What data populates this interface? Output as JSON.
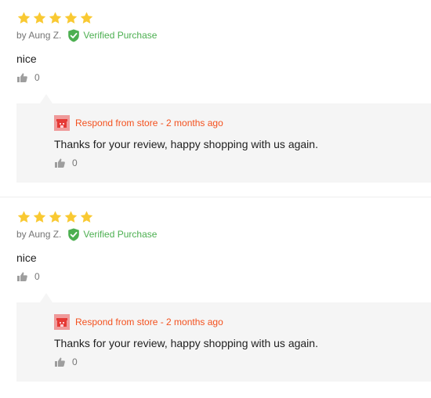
{
  "colors": {
    "star": "#f9c932",
    "verified": "#4caf50",
    "store_accent": "#f4511e",
    "reply_bg": "#f5f5f5"
  },
  "reviews": [
    {
      "rating": 5,
      "author": "by Aung Z.",
      "verified_label": "Verified Purchase",
      "text": "nice",
      "likes": "0",
      "reply": {
        "header": "Respond from store - 2 months ago",
        "text": "Thanks for your review, happy shopping with us again.",
        "likes": "0"
      }
    },
    {
      "rating": 5,
      "author": "by Aung Z.",
      "verified_label": "Verified Purchase",
      "text": "nice",
      "likes": "0",
      "reply": {
        "header": "Respond from store - 2 months ago",
        "text": "Thanks for your review, happy shopping with us again.",
        "likes": "0"
      }
    }
  ]
}
